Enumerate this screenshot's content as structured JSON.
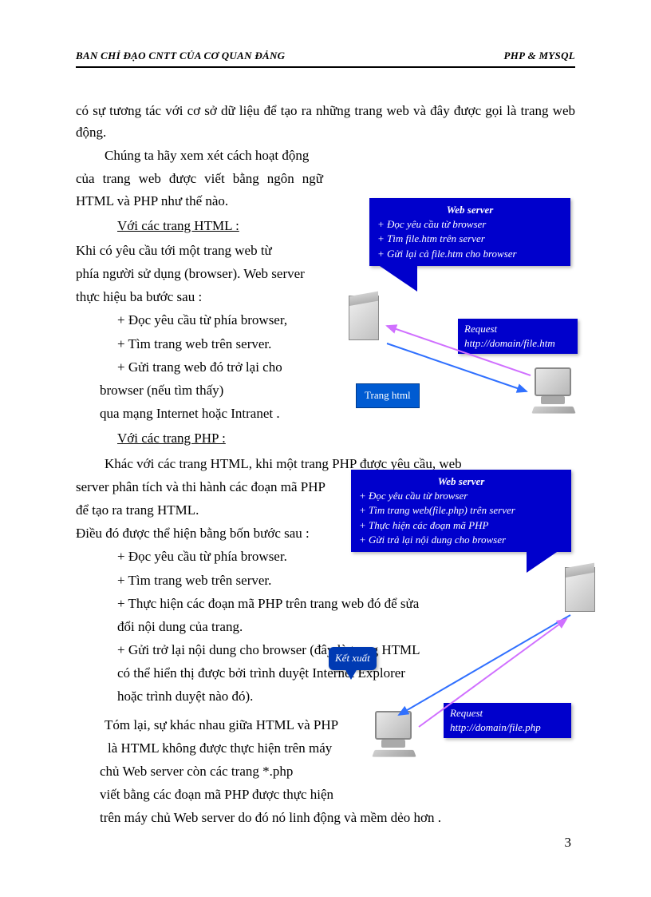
{
  "header": {
    "left": "BAN CHỈ ĐẠO CNTT CỦA CƠ QUAN ĐẢNG",
    "right": "PHP & MYSQL"
  },
  "page_number": "3",
  "paragraphs": {
    "p1": "có sự tương tác với cơ sở dữ liệu để tạo ra những trang web và đây được gọi là trang web động.",
    "p2": "Chúng ta hãy xem xét cách hoạt động",
    "p3": "của trang web được viết bằng ngôn ngữ HTML và PHP như thế nào.",
    "sec1": "Với các trang HTML :",
    "p4a": "Khi có yêu cầu tới một trang web từ",
    "p4b": "phía người sử dụng (browser). Web server",
    "p4c": " thực hiệu ba bước sau :",
    "b1": "+ Đọc yêu cầu từ phía browser,",
    "b2": "+ Tìm trang web trên server.",
    "b3a": "+ Gửi trang web đó trở lại cho",
    "b3b": "browser (nếu tìm thấy)",
    "b3c": "qua mạng Internet hoặc Intranet .",
    "sec2": "Với các trang PHP :",
    "p5a": "Khác với các trang HTML, khi một trang PHP được yêu cầu, web",
    "p5b": "server phân tích và thi hành các đoạn mã PHP",
    "p5c": " để tạo ra trang HTML.",
    "p6": "Điều đó được thể hiện bằng bốn bước sau :",
    "c1": "+ Đọc yêu cầu từ phía browser.",
    "c2": "+ Tìm trang web trên server.",
    "c3a": "+ Thực hiện các đoạn mã PHP trên trang web đó để sửa",
    "c3b": "đổi nội dung của trang.",
    "c4a": "+ Gửi trở lại nội dung cho browser (đây là trang HTML",
    "c4b": " có thể hiển thị được bởi trình duyệt Internet Explorer",
    "c4c": " hoặc trình duyệt nào đó).",
    "p7a": "Tóm lại, sự khác nhau giữa HTML và PHP",
    "p7b": " là HTML không được thực hiện trên máy",
    "p7c": "chủ Web server còn các trang *.php",
    "p7d": "viết bằng các đoạn mã PHP được thực hiện",
    "p7e": "trên máy chủ Web server do đó nó linh động và mềm dẻo hơn ."
  },
  "diagram1": {
    "ws_title": "Web server",
    "ws_l1": "+ Đọc yêu cầu từ browser",
    "ws_l2": "+ Tìm file.htm trên server",
    "ws_l3": "+ Gửi lại cả file.htm cho browser",
    "req_title": "Request",
    "req_url": "http://domain/file.htm",
    "tranghtml": "Trang html"
  },
  "diagram2": {
    "ws_title": "Web server",
    "ws_l1": "+ Đọc yêu cầu từ browser",
    "ws_l2": "+ Tìm trang web(file.php) trên server",
    "ws_l3": "+ Thực hiện các đoạn mã PHP",
    "ws_l4": "+ Gửi trả lại nội dung cho browser",
    "ketxuat": "Kết xuất",
    "req_title": "Request",
    "req_url": "http://domain/file.php"
  }
}
